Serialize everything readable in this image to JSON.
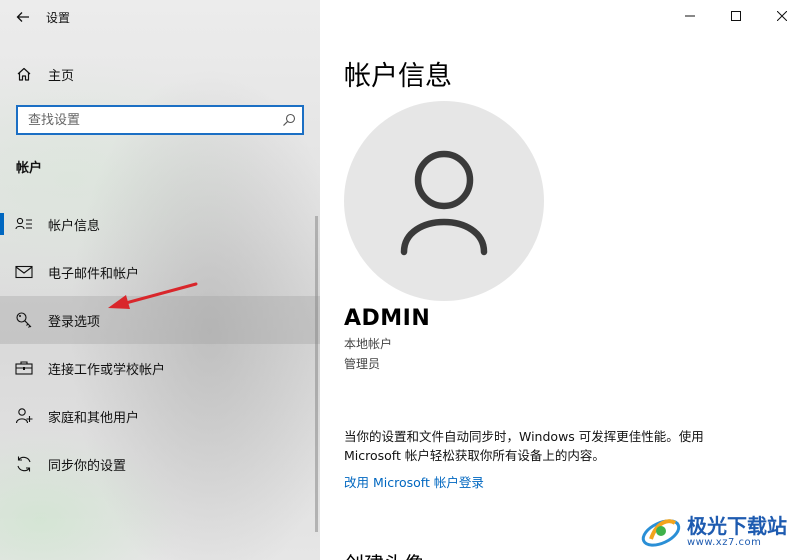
{
  "window": {
    "title": "设置"
  },
  "sidebar": {
    "home_label": "主页",
    "search_placeholder": "查找设置",
    "section_title": "帐户",
    "items": [
      {
        "label": "帐户信息",
        "icon": "account-info-icon",
        "selected": true
      },
      {
        "label": "电子邮件和帐户",
        "icon": "mail-icon"
      },
      {
        "label": "登录选项",
        "icon": "key-icon",
        "hovered": true
      },
      {
        "label": "连接工作或学校帐户",
        "icon": "briefcase-icon"
      },
      {
        "label": "家庭和其他用户",
        "icon": "person-add-icon"
      },
      {
        "label": "同步你的设置",
        "icon": "sync-icon"
      }
    ]
  },
  "main": {
    "page_title": "帐户信息",
    "user_name": "ADMIN",
    "account_type": "本地帐户",
    "account_role": "管理员",
    "sync_description": "当你的设置和文件自动同步时，Windows 可发挥更佳性能。使用 Microsoft 帐户轻松获取你所有设备上的内容。",
    "ms_login_link": "改用 Microsoft 帐户登录",
    "create_avatar_heading": "创建头像"
  },
  "watermark": {
    "text": "极光下载站",
    "url": "www.xz7.com"
  },
  "colors": {
    "accent": "#0067c0",
    "link": "#0067c0",
    "annotation_arrow": "#d9262b"
  }
}
